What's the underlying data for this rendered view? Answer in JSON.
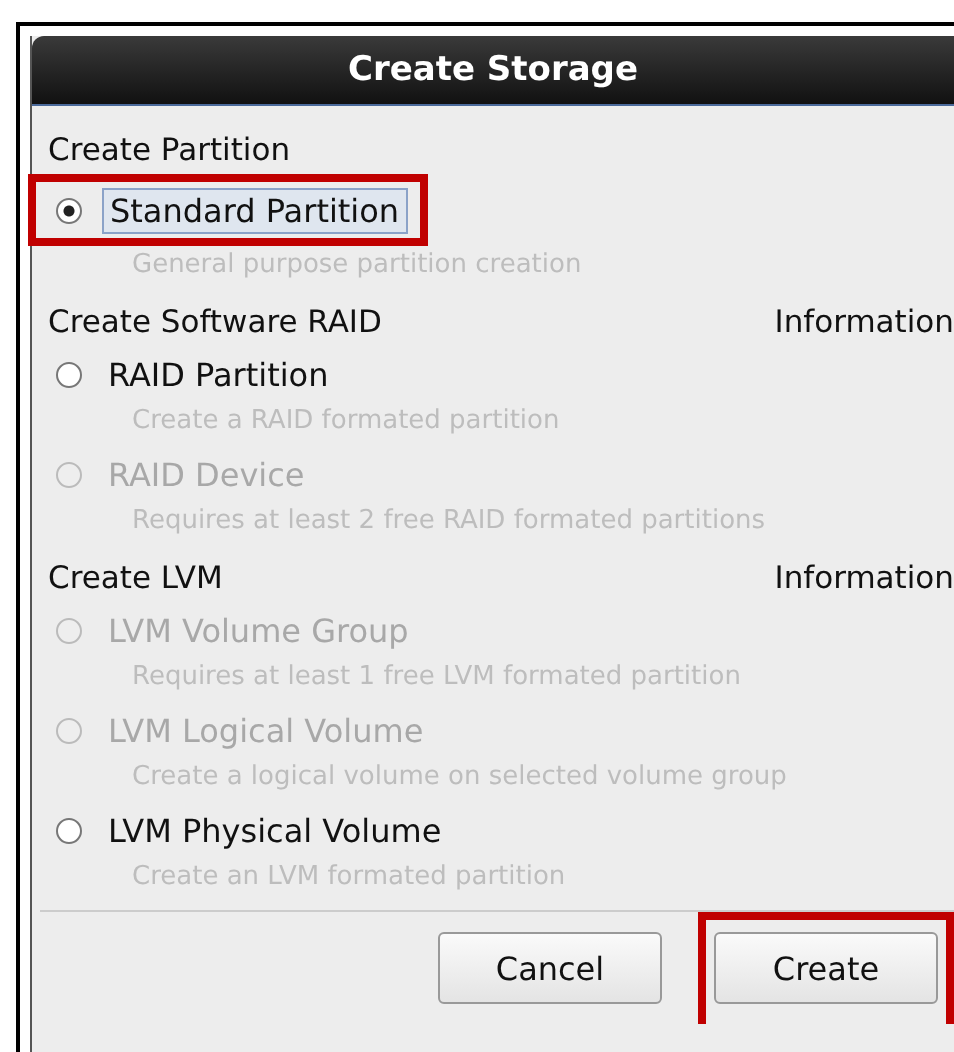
{
  "window": {
    "title": "Create Storage"
  },
  "sections": [
    {
      "heading": "Create Partition",
      "options": [
        {
          "label": "Standard Partition",
          "description": "General purpose partition creation",
          "selected": true,
          "disabled": false,
          "highlighted": true
        }
      ]
    },
    {
      "heading": "Create Software RAID",
      "info": "Information",
      "options": [
        {
          "label": "RAID Partition",
          "description": "Create a RAID formated partition",
          "selected": false,
          "disabled": false,
          "highlighted": false
        },
        {
          "label": "RAID Device",
          "description": "Requires at least 2 free RAID formated partitions",
          "selected": false,
          "disabled": true,
          "highlighted": false
        }
      ]
    },
    {
      "heading": "Create LVM",
      "info": "Information",
      "options": [
        {
          "label": "LVM Volume Group",
          "description": "Requires at least 1 free LVM formated partition",
          "selected": false,
          "disabled": true,
          "highlighted": false
        },
        {
          "label": "LVM Logical Volume",
          "description": "Create a logical volume on selected volume group",
          "selected": false,
          "disabled": true,
          "highlighted": false
        },
        {
          "label": "LVM Physical Volume",
          "description": "Create an LVM formated partition",
          "selected": false,
          "disabled": false,
          "highlighted": false
        }
      ]
    }
  ],
  "buttons": [
    {
      "label": "Cancel",
      "highlighted": false
    },
    {
      "label": "Create",
      "highlighted": true
    }
  ]
}
